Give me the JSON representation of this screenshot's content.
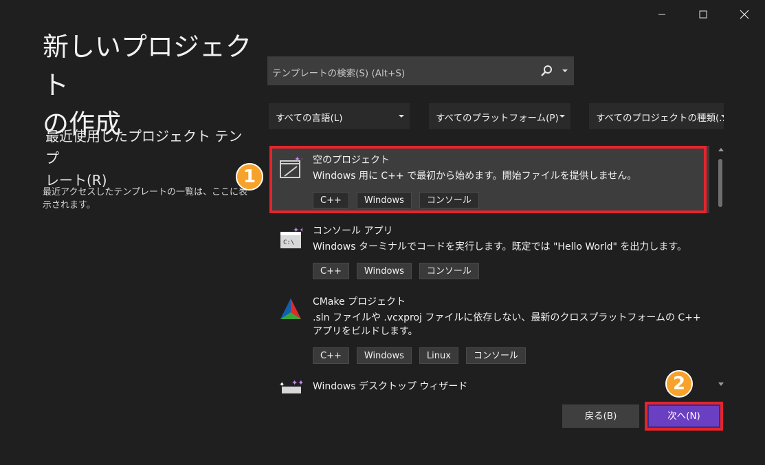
{
  "window": {
    "minimize_label": "—",
    "maximize_label": "□",
    "close_label": "✕"
  },
  "page_title_line1": "新しいプロジェクト",
  "page_title_line2": "の作成",
  "recent": {
    "heading_line1": "最近使用したプロジェクト テンプ",
    "heading_line2": "レート(R)",
    "description": "最近アクセスしたテンプレートの一覧は、ここに表示されます。"
  },
  "search": {
    "placeholder": "テンプレートの検索(S) (Alt+S)"
  },
  "filters": {
    "language": "すべての言語(L)",
    "platform": "すべてのプラットフォーム(P)",
    "project_type": "すべてのプロジェクトの種類(..."
  },
  "templates": [
    {
      "title": "空のプロジェクト",
      "description": "Windows 用に C++ で最初から始めます。開始ファイルを提供しません。",
      "tags": [
        "C++",
        "Windows",
        "コンソール"
      ],
      "icon": "empty-project-icon",
      "selected": true
    },
    {
      "title": "コンソール アプリ",
      "description": "Windows ターミナルでコードを実行します。既定では \"Hello World\" を出力します。",
      "tags": [
        "C++",
        "Windows",
        "コンソール"
      ],
      "icon": "console-app-icon",
      "selected": false
    },
    {
      "title": "CMake プロジェクト",
      "description": ".sln ファイルや .vcxproj ファイルに依存しない、最新のクロスプラットフォームの C++ アプリをビルドします。",
      "tags": [
        "C++",
        "Windows",
        "Linux",
        "コンソール"
      ],
      "icon": "cmake-icon",
      "selected": false
    },
    {
      "title": "Windows デスクトップ ウィザード",
      "description": "",
      "tags": [],
      "icon": "desktop-wizard-icon",
      "selected": false
    }
  ],
  "markers": {
    "first": "1",
    "second": "2"
  },
  "buttons": {
    "back": "戻る(B)",
    "next": "次へ(N)"
  },
  "colors": {
    "background": "#1f1f1f",
    "selected_item": "#3d3d3d",
    "highlight_red": "#e5242b",
    "marker_orange": "#f7a22b",
    "next_button": "#6b3fc2"
  }
}
